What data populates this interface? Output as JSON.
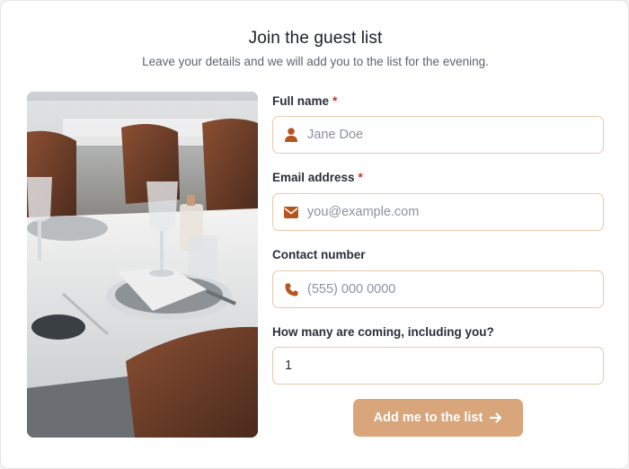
{
  "header": {
    "title": "Join the guest list",
    "subtitle": "Leave your details and we will add you to the list for the evening."
  },
  "form": {
    "name": {
      "label": "Full name",
      "required_mark": "*",
      "placeholder": "Jane Doe",
      "icon": "user-icon"
    },
    "email": {
      "label": "Email address",
      "required_mark": "*",
      "placeholder": "you@example.com",
      "icon": "envelope-icon"
    },
    "phone": {
      "label": "Contact number",
      "placeholder": "(555) 000 0000",
      "icon": "phone-icon"
    },
    "guests": {
      "label": "How many are coming, including you?",
      "value": "1"
    },
    "submit_label": "Add me to the list"
  },
  "colors": {
    "accent": "#d9a57a",
    "icon": "#b5561f",
    "input_border": "#e8c9ad",
    "required": "#c0392b"
  }
}
